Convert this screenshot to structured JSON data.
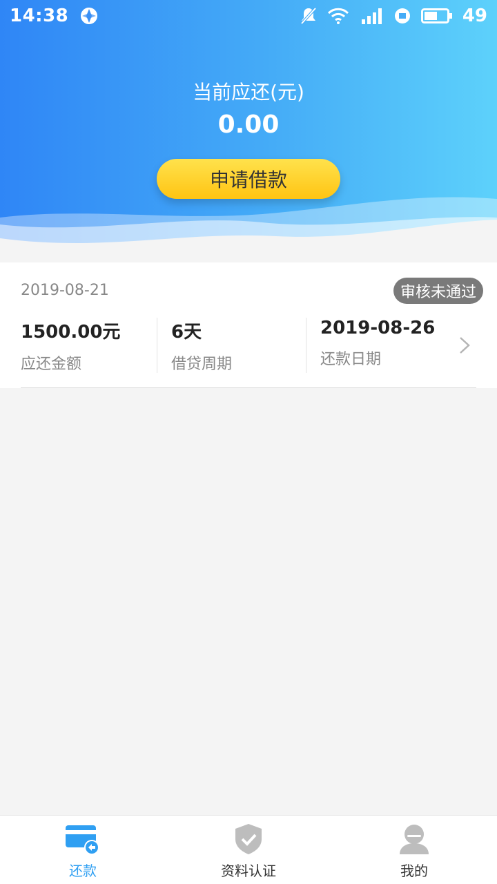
{
  "status_bar": {
    "time": "14:38",
    "battery": "49",
    "icons": [
      "app-icon",
      "bell-muted-icon",
      "wifi-icon",
      "signal-4g-icon",
      "hd-icon",
      "battery-icon"
    ]
  },
  "header": {
    "title": "当前应还(元)",
    "amount": "0.00",
    "apply_label": "申请借款"
  },
  "loan": {
    "date": "2019-08-21",
    "status": "审核未通过",
    "columns": [
      {
        "value": "1500.00元",
        "label": "应还金额"
      },
      {
        "value": "6天",
        "label": "借贷周期"
      },
      {
        "value": "2019-08-26",
        "label": "还款日期"
      }
    ]
  },
  "nav": {
    "items": [
      {
        "label": "还款",
        "icon": "card-repay-icon",
        "active": true
      },
      {
        "label": "资料认证",
        "icon": "shield-check-icon",
        "active": false
      },
      {
        "label": "我的",
        "icon": "user-icon",
        "active": false
      }
    ]
  },
  "colors": {
    "header_start": "#2f86f6",
    "header_end": "#5dd1fb",
    "button": "#ffc413",
    "active_nav": "#2f9ff2",
    "badge": "#7a7a7a"
  }
}
